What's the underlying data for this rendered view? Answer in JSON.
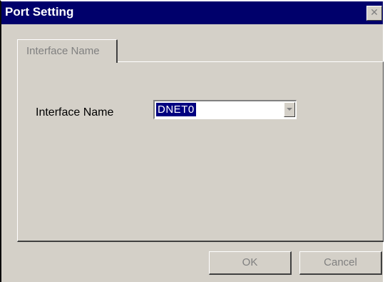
{
  "window": {
    "title": "Port Setting",
    "close_glyph": "✕"
  },
  "tabs": [
    {
      "label": "Interface Name",
      "selected": true
    }
  ],
  "form": {
    "interface_name": {
      "label": "Interface Name",
      "value": "DNET0",
      "dropdown_icon": "chevron-down-icon"
    }
  },
  "buttons": {
    "ok_label": "OK",
    "cancel_label": "Cancel"
  },
  "colors": {
    "titlebar": "#00006b",
    "face": "#d4d0c8",
    "selection": "#000080",
    "disabled_text": "#808080"
  }
}
